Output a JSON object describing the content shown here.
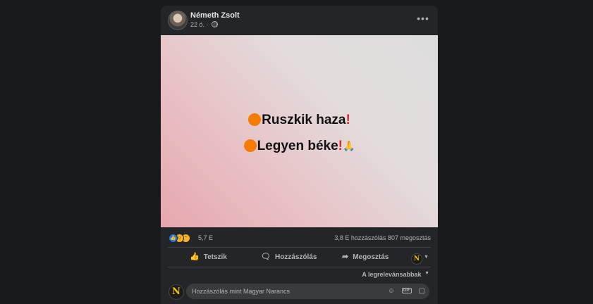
{
  "post": {
    "author": "Németh Zsolt",
    "time": "22 ó.",
    "separator": "·",
    "image_text": {
      "line1": "Ruszkik haza",
      "line2": "Legyen béke"
    }
  },
  "stats": {
    "reactions": [
      "like",
      "haha",
      "wow"
    ],
    "reaction_count": "5,7 E",
    "comments": "3,8 E hozzászólás",
    "shares": "807 megosztás"
  },
  "actions": {
    "like": "Tetszik",
    "comment": "Hozzászólás",
    "share": "Megosztás"
  },
  "sort_label": "A legrelevánsabbak",
  "comment_box": {
    "placeholder": "Hozzászólás mint Magyar Narancs"
  },
  "page_logo_letter": "N",
  "colors": {
    "background": "#18191a",
    "card": "#242526",
    "input": "#3a3b3c",
    "secondary_text": "#b0b3b8",
    "like_blue": "#1877f2",
    "orange_circle": "#f57c00",
    "exclamation_red": "#e0242c",
    "logo_yellow": "#f5c400"
  }
}
